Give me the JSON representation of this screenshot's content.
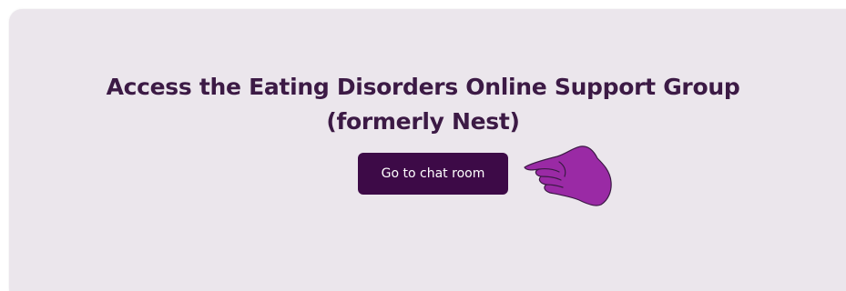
{
  "banner": {
    "title_line1": "Access the Eating Disorders Online Support Group",
    "title_line2": "(formerly Nest)",
    "button_label": "Go to chat room",
    "icon": "pointing-hand-icon"
  },
  "colors": {
    "card_background": "#ebe6ec",
    "title_text": "#3c1a45",
    "button_background": "#3d0a47",
    "button_text": "#ffffff",
    "hand_fill": "#9a2aa5"
  }
}
